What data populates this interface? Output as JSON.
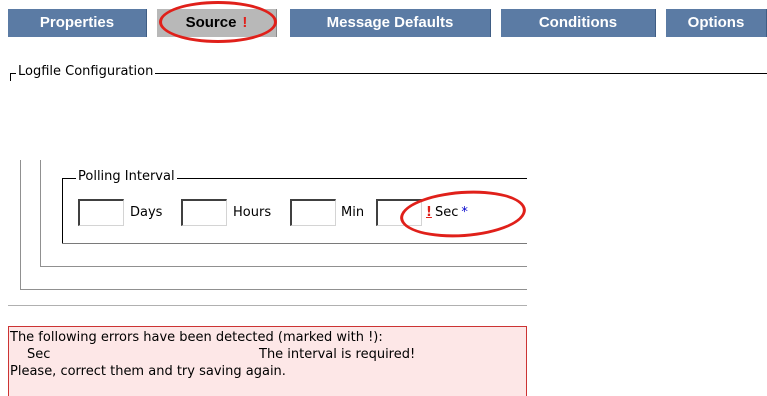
{
  "tabs": [
    {
      "label": "Properties",
      "active": false
    },
    {
      "label": "Source",
      "active": true,
      "error_mark": "!"
    },
    {
      "label": "Message Defaults",
      "active": false
    },
    {
      "label": "Conditions",
      "active": false
    },
    {
      "label": "Options",
      "active": false
    }
  ],
  "logfile_section": {
    "legend": "Logfile Configuration"
  },
  "polling_interval": {
    "legend": "Polling Interval",
    "fields": [
      {
        "unit": "Days",
        "value": ""
      },
      {
        "unit": "Hours",
        "value": ""
      },
      {
        "unit": "Min",
        "value": ""
      },
      {
        "unit": "Sec",
        "value": "",
        "error_mark": "!",
        "required_mark": "*"
      }
    ]
  },
  "errors": {
    "header": "The following errors have been detected (marked with !):",
    "items": [
      {
        "field": "Sec",
        "message": "The interval is required!"
      }
    ],
    "footer": "Please, correct them and try saving again."
  },
  "colors": {
    "tab_bg": "#5b7ba4",
    "tab_active_bg": "#b8b8b8",
    "error_red": "#e0201a",
    "error_panel_bg": "#fde7e7",
    "required_blue": "#0000cc"
  }
}
